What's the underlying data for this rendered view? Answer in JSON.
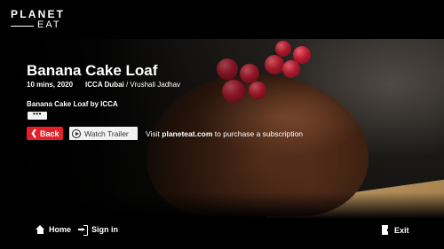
{
  "brand": {
    "line1": "PLANET",
    "line2": "EAT"
  },
  "content": {
    "title": "Banana Cake Loaf",
    "duration_year": "10 mins, 2020",
    "provider": "ICCA Dubai",
    "separator": " / ",
    "author": "Vrushali Jadhav",
    "subtitle": "Banana Cake Loaf by ICCA",
    "more_label": "•••"
  },
  "actions": {
    "back_label": "Back",
    "trailer_label": "Watch Trailer",
    "subscribe_prefix": "Visit ",
    "subscribe_site": "planeteat.com",
    "subscribe_suffix": " to purchase a subscription"
  },
  "nav": {
    "home_label": "Home",
    "signin_label": "Sign in",
    "exit_label": "Exit"
  },
  "colors": {
    "accent": "#e3202a",
    "background": "#000000",
    "button_light": "#f2f2f2"
  }
}
